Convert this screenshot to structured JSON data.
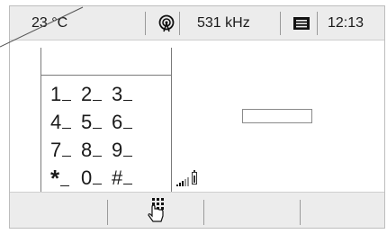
{
  "status_bar": {
    "temperature": "23 °C",
    "radio_icon": "radio-signal-icon",
    "frequency": "531 kHz",
    "messages_icon": "message-icon",
    "time": "12:13"
  },
  "keypad": {
    "rows": [
      [
        "1",
        "2",
        "3"
      ],
      [
        "4",
        "5",
        "6"
      ],
      [
        "7",
        "8",
        "9"
      ],
      [
        "*",
        "0",
        "#"
      ]
    ]
  },
  "indicators": {
    "signal_icon": "signal-bars-icon",
    "battery_icon": "battery-icon"
  },
  "softkeys": {
    "keypad_icon": "keypad-touch-icon"
  }
}
